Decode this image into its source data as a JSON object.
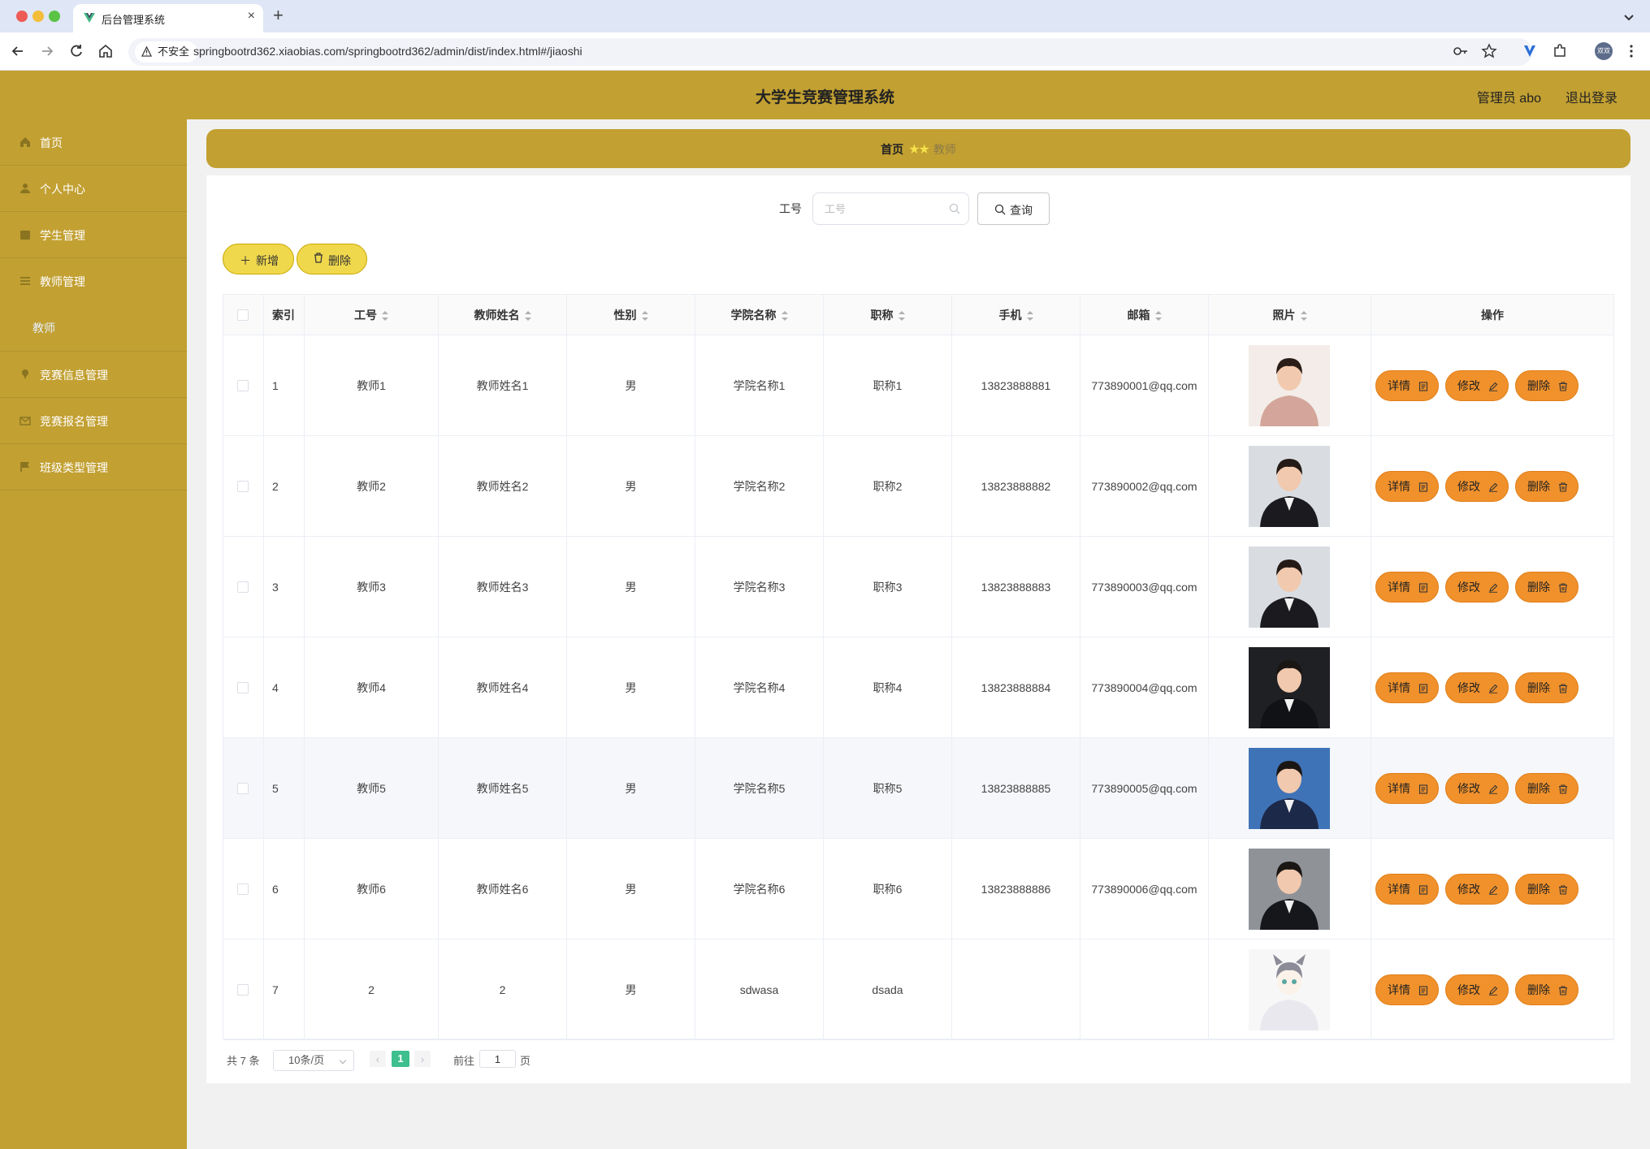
{
  "browser": {
    "tab_title": "后台管理系统",
    "insecure_label": "不安全",
    "url": "springbootrd362.xiaobias.com/springbootrd362/admin/dist/index.html#/jiaoshi",
    "avatar_text": "双双"
  },
  "header": {
    "title": "大学生竞赛管理系统",
    "admin_label": "管理员 abo",
    "logout_label": "退出登录"
  },
  "sidebar": {
    "items": [
      {
        "label": "首页",
        "icon": "home-icon"
      },
      {
        "label": "个人中心",
        "icon": "user-icon"
      },
      {
        "label": "学生管理",
        "icon": "student-icon"
      },
      {
        "label": "教师管理",
        "icon": "list-icon"
      },
      {
        "label": "竞赛信息管理",
        "icon": "pin-icon"
      },
      {
        "label": "竞赛报名管理",
        "icon": "mail-icon"
      },
      {
        "label": "班级类型管理",
        "icon": "flag-icon"
      }
    ],
    "sub_item": "教师"
  },
  "breadcrumb": {
    "home": "首页",
    "current": "教师"
  },
  "search": {
    "label": "工号",
    "placeholder": "工号",
    "button": "查询"
  },
  "actions": {
    "add": "新增",
    "delete": "删除"
  },
  "table": {
    "headers": [
      "索引",
      "工号",
      "教师姓名",
      "性别",
      "学院名称",
      "职称",
      "手机",
      "邮箱",
      "照片",
      "操作"
    ],
    "rows": [
      {
        "index": "1",
        "id": "教师1",
        "name": "教师姓名1",
        "gender": "男",
        "college": "学院名称1",
        "title": "职称1",
        "phone": "13823888881",
        "email": "773890001@qq.com"
      },
      {
        "index": "2",
        "id": "教师2",
        "name": "教师姓名2",
        "gender": "男",
        "college": "学院名称2",
        "title": "职称2",
        "phone": "13823888882",
        "email": "773890002@qq.com"
      },
      {
        "index": "3",
        "id": "教师3",
        "name": "教师姓名3",
        "gender": "男",
        "college": "学院名称3",
        "title": "职称3",
        "phone": "13823888883",
        "email": "773890003@qq.com"
      },
      {
        "index": "4",
        "id": "教师4",
        "name": "教师姓名4",
        "gender": "男",
        "college": "学院名称4",
        "title": "职称4",
        "phone": "13823888884",
        "email": "773890004@qq.com"
      },
      {
        "index": "5",
        "id": "教师5",
        "name": "教师姓名5",
        "gender": "男",
        "college": "学院名称5",
        "title": "职称5",
        "phone": "13823888885",
        "email": "773890005@qq.com"
      },
      {
        "index": "6",
        "id": "教师6",
        "name": "教师姓名6",
        "gender": "男",
        "college": "学院名称6",
        "title": "职称6",
        "phone": "13823888886",
        "email": "773890006@qq.com"
      },
      {
        "index": "7",
        "id": "2",
        "name": "2",
        "gender": "男",
        "college": "sdwasa",
        "title": "dsada",
        "phone": "",
        "email": ""
      }
    ],
    "row_buttons": {
      "detail": "详情",
      "edit": "修改",
      "delete": "删除"
    }
  },
  "pagination": {
    "total": "共 7 条",
    "page_size": "10条/页",
    "current_page": "1",
    "goto_label": "前往",
    "goto_value": "1",
    "page_suffix": "页"
  },
  "colors": {
    "theme": "#c2a032",
    "button_yellow": "#f0d84c",
    "button_orange": "#f0912c",
    "active_page": "#3dbf8e"
  }
}
